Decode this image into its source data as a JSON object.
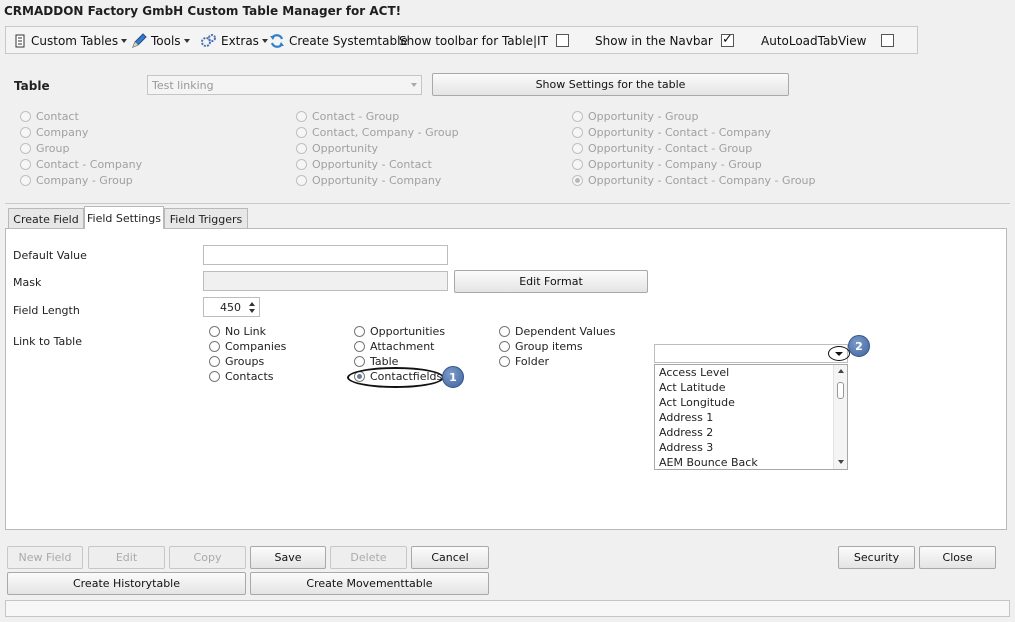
{
  "window": {
    "title": "CRMADDON Factory GmbH Custom Table Manager for ACT!"
  },
  "toolbar": {
    "custom_tables": "Custom Tables",
    "tools": "Tools",
    "extras": "Extras",
    "create_systemtable": "Create Systemtable",
    "show_toolbar_label": "Show toolbar for Table|IT",
    "show_toolbar_checked": false,
    "show_navbar_label": "Show in the Navbar",
    "show_navbar_checked": true,
    "autoload_label": "AutoLoadTabView",
    "autoload_checked": false
  },
  "table_section": {
    "label": "Table",
    "selected_table": "Test linking",
    "show_settings_button": "Show Settings for the table",
    "options": [
      [
        "Contact",
        "Company",
        "Group",
        "Contact - Company",
        "Company - Group"
      ],
      [
        "Contact - Group",
        "Contact, Company - Group",
        "Opportunity",
        "Opportunity - Contact",
        "Opportunity - Company"
      ],
      [
        "Opportunity - Group",
        "Opportunity - Contact - Company",
        "Opportunity - Contact - Group",
        "Opportunity - Company - Group",
        "Opportunity - Contact - Company - Group"
      ]
    ],
    "selected_option": "Opportunity - Contact - Company - Group"
  },
  "tabs": [
    "Create Field",
    "Field Settings",
    "Field Triggers"
  ],
  "active_tab": "Field Settings",
  "field_settings": {
    "default_value_label": "Default Value",
    "default_value": "",
    "mask_label": "Mask",
    "mask_value": "",
    "edit_format_button": "Edit Format",
    "field_length_label": "Field Length",
    "field_length": "450",
    "link_to_table_label": "Link to Table",
    "link_options": [
      [
        "No Link",
        "Companies",
        "Groups",
        "Contacts"
      ],
      [
        "Opportunities",
        "Attachment",
        "Table",
        "Contactfields"
      ],
      [
        "Dependent Values",
        "Group items",
        "Folder"
      ]
    ],
    "selected_link": "Contactfields",
    "field_combo_value": "",
    "field_list": [
      "Access Level",
      "Act Latitude",
      "Act Longitude",
      "Address 1",
      "Address 2",
      "Address 3",
      "AEM Bounce Back"
    ]
  },
  "callouts": [
    "1",
    "2"
  ],
  "buttons": {
    "new_field": "New Field",
    "edit": "Edit",
    "copy": "Copy",
    "save": "Save",
    "delete": "Delete",
    "cancel": "Cancel",
    "security": "Security",
    "close": "Close",
    "create_historytable": "Create Historytable",
    "create_movementtable": "Create Movementtable"
  }
}
